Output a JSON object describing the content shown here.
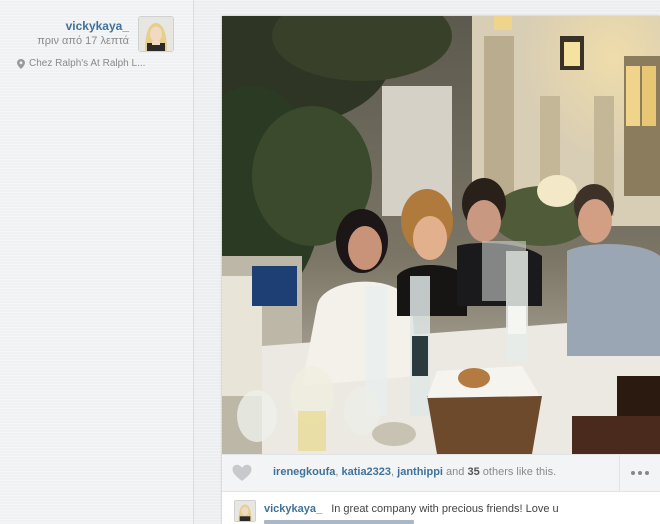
{
  "post": {
    "username": "vickykaya_",
    "time_ago": "πριν από 17 λεπτά",
    "location": "Chez Ralph's At Ralph L..."
  },
  "likes": {
    "users": [
      "irenegkoufa",
      "katia2323",
      "janthippi"
    ],
    "others_count": "35",
    "suffix": "others like this.",
    "and": "and"
  },
  "comment": {
    "username": "vickykaya_",
    "text": "In great company with precious friends! Love u"
  },
  "icons": {
    "location": "map-pin-icon",
    "like": "heart-icon",
    "more": "more-dots-icon"
  },
  "colors": {
    "link": "#3f729b",
    "muted": "#8a8a8a",
    "bar": "#f3f4f5"
  }
}
